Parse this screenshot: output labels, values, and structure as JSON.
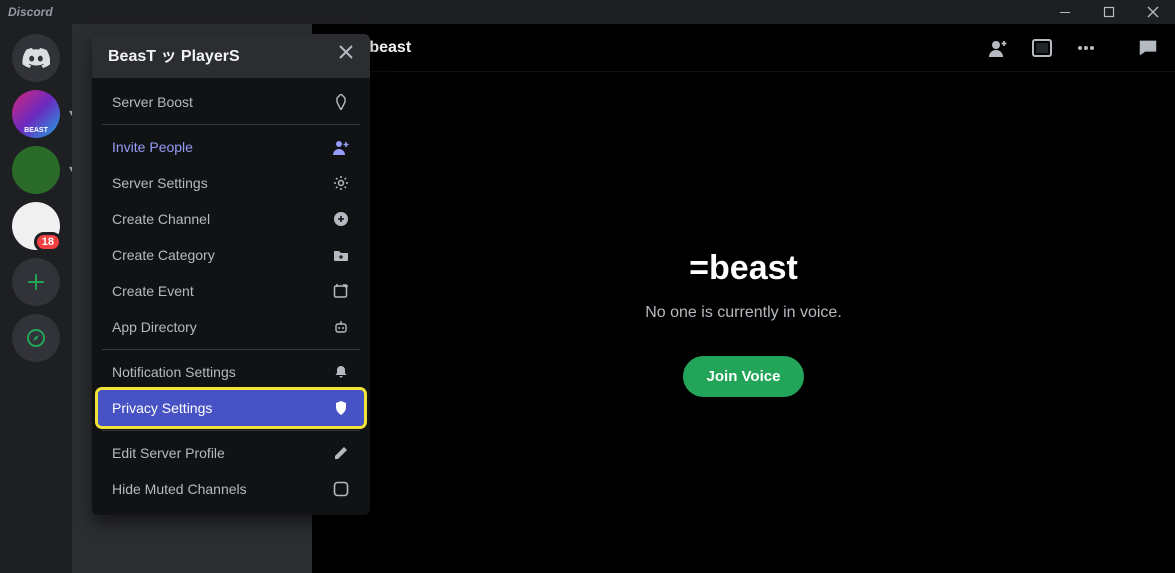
{
  "titlebar": {
    "app_name": "Discord"
  },
  "servers": {
    "badge_count": "18"
  },
  "dropdown": {
    "header": "BeasT ッ PlayerS",
    "items": {
      "boost": "Server Boost",
      "invite": "Invite People",
      "settings": "Server Settings",
      "create_channel": "Create Channel",
      "create_category": "Create Category",
      "create_event": "Create Event",
      "app_directory": "App Directory",
      "notifications": "Notification Settings",
      "privacy": "Privacy Settings",
      "edit_profile": "Edit Server Profile",
      "hide_muted": "Hide Muted Channels"
    }
  },
  "main": {
    "channel_name": "=beast",
    "voice_title": "=beast",
    "voice_subtitle": "No one is currently in voice.",
    "join_button": "Join Voice"
  }
}
